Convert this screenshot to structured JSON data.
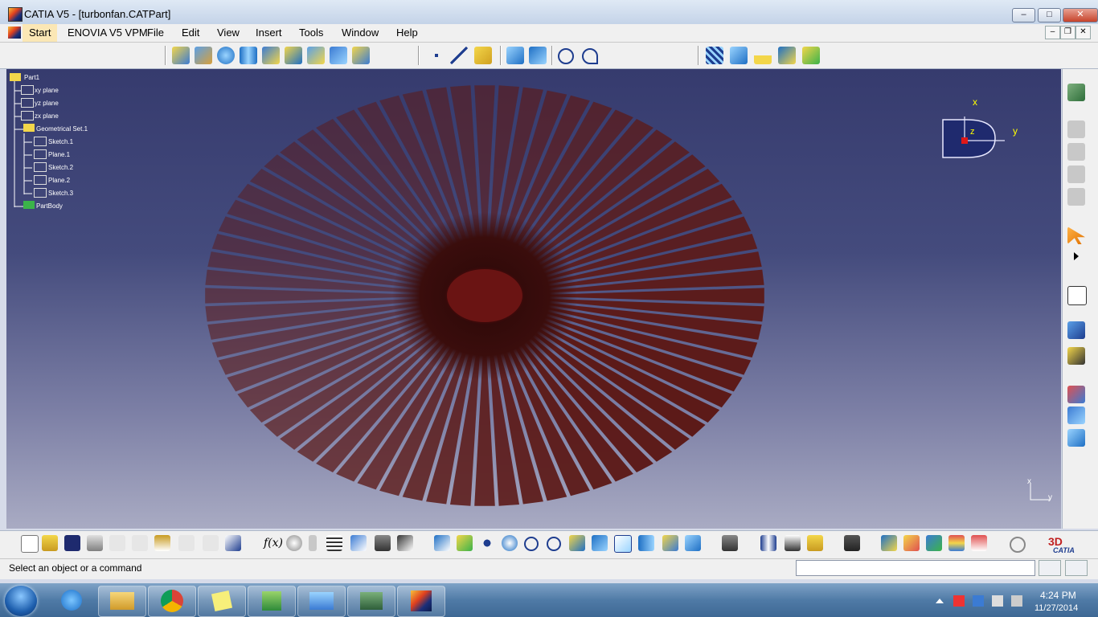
{
  "window": {
    "title": "CATIA V5 - [turbonfan.CATPart]",
    "minimize": "–",
    "maximize": "□",
    "close": "✕"
  },
  "menu": {
    "items": [
      "Start",
      "ENOVIA V5 VPM",
      "File",
      "Edit",
      "View",
      "Insert",
      "Tools",
      "Window",
      "Help"
    ],
    "mdi": {
      "minimize": "–",
      "restore": "❐",
      "close": "✕"
    }
  },
  "tree": {
    "root": "Part1",
    "nodes": [
      "xy plane",
      "yz plane",
      "zx plane",
      "Geometrical Set.1",
      "Sketch.1",
      "Plane.1",
      "Sketch.2",
      "Plane.2",
      "Sketch.3",
      "PartBody"
    ]
  },
  "compass": {
    "x": "x",
    "y": "y",
    "z": "z"
  },
  "axis_small": {
    "x": "x",
    "y": "y"
  },
  "toolbar_bottom": {
    "fx_label": "f(x)"
  },
  "status": {
    "message": "Select an object or a command",
    "command_value": ""
  },
  "taskbar": {
    "time": "4:24 PM",
    "date": "11/27/2014"
  },
  "brand": {
    "catia": "CATIA"
  },
  "colors": {
    "blade": "#5c1a18",
    "hub": "#6a1413",
    "viewport_top": "#363b6e",
    "compass": "#ffff00"
  }
}
